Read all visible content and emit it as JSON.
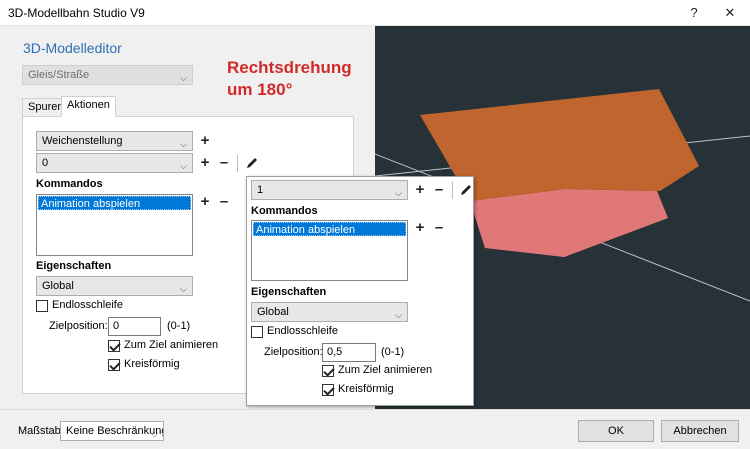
{
  "window": {
    "title": "3D-Modellbahn Studio V9",
    "help_glyph": "?",
    "close_glyph": "✕"
  },
  "editor": {
    "heading": "3D-Modelleditor",
    "category_value": "Gleis/Straße"
  },
  "annotation": {
    "line1": "Rechtsdrehung",
    "line2": "um 180°",
    "color": "#d22a2a"
  },
  "tabs": [
    "Spuren",
    "Aktionen"
  ],
  "actions": {
    "action_value": "Weichenstellung",
    "state_value": "0",
    "commands_label": "Kommandos",
    "commands": [
      "Animation abspielen"
    ],
    "properties_label": "Eigenschaften",
    "properties_value": "Global",
    "endless_label": "Endlosschleife",
    "endless_checked": false,
    "target_label": "Zielposition:",
    "target_value": "0",
    "target_range": "(0-1)",
    "animate_label": "Zum Ziel animieren",
    "animate_checked": true,
    "circular_label": "Kreisförmig",
    "circular_checked": true
  },
  "overlay": {
    "state_value": "1",
    "commands_label": "Kommandos",
    "commands": [
      "Animation abspielen"
    ],
    "properties_label": "Eigenschaften",
    "properties_value": "Global",
    "endless_label": "Endlosschleife",
    "endless_checked": false,
    "target_label": "Zielposition:",
    "target_value": "0,5",
    "target_range": "(0-1)",
    "animate_label": "Zum Ziel animieren",
    "animate_checked": true,
    "circular_label": "Kreisförmig",
    "circular_checked": true
  },
  "footer": {
    "scale_label": "Maßstab:",
    "scale_value": "Keine Beschränkung",
    "ok_label": "OK",
    "cancel_label": "Abbrechen"
  },
  "icons": {
    "plus": "+",
    "minus": "–",
    "dropdown_arrow": "⌵",
    "edit_icon": "pencil-icon"
  },
  "viewport": {
    "background": "#263238",
    "top_face_color": "#c0652d",
    "lower_face_color": "#e07878",
    "side_face_color": "#d67ba8"
  }
}
